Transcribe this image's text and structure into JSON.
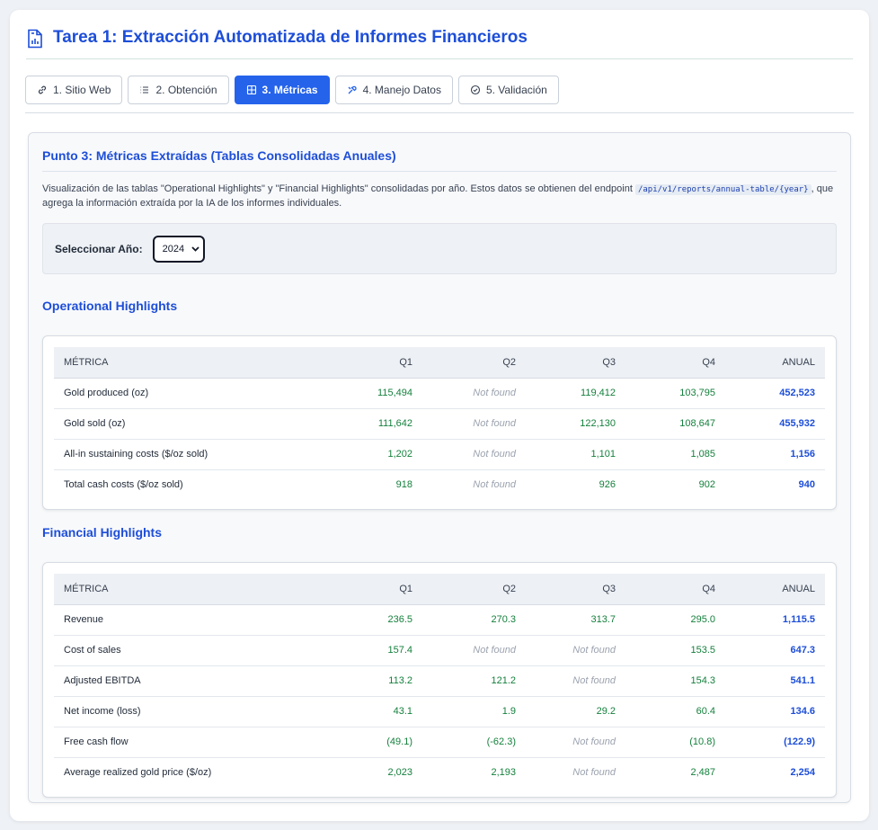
{
  "header": {
    "title": "Tarea 1: Extracción Automatizada de Informes Financieros",
    "icon": "document-chart-icon"
  },
  "tabs": [
    {
      "label": "1. Sitio Web",
      "icon": "link-icon",
      "active": false
    },
    {
      "label": "2. Obtención",
      "icon": "list-icon",
      "active": false
    },
    {
      "label": "3. Métricas",
      "icon": "grid-icon",
      "active": true
    },
    {
      "label": "4. Manejo Datos",
      "icon": "tools-icon",
      "active": false
    },
    {
      "label": "5. Validación",
      "icon": "check-circle-icon",
      "active": false
    }
  ],
  "panel": {
    "title": "Punto 3: Métricas Extraídas (Tablas Consolidadas Anuales)",
    "desc_before": "Visualización de las tablas \"Operational Highlights\" y \"Financial Highlights\" consolidadas por año. Estos datos se obtienen del endpoint ",
    "endpoint": "/api/v1/reports/annual-table/{year}",
    "desc_after": ", que agrega la información extraída por la IA de los informes individuales.",
    "year_label": "Seleccionar Año:",
    "year_value": "2024"
  },
  "operational": {
    "title": "Operational Highlights",
    "columns": [
      "MÉTRICA",
      "Q1",
      "Q2",
      "Q3",
      "Q4",
      "ANUAL"
    ],
    "rows": [
      [
        "Gold produced (oz)",
        "115,494",
        "Not found",
        "119,412",
        "103,795",
        "452,523"
      ],
      [
        "Gold sold (oz)",
        "111,642",
        "Not found",
        "122,130",
        "108,647",
        "455,932"
      ],
      [
        "All-in sustaining costs ($/oz sold)",
        "1,202",
        "Not found",
        "1,101",
        "1,085",
        "1,156"
      ],
      [
        "Total cash costs ($/oz sold)",
        "918",
        "Not found",
        "926",
        "902",
        "940"
      ]
    ]
  },
  "financial": {
    "title": "Financial Highlights",
    "columns": [
      "MÉTRICA",
      "Q1",
      "Q2",
      "Q3",
      "Q4",
      "ANUAL"
    ],
    "rows": [
      [
        "Revenue",
        "236.5",
        "270.3",
        "313.7",
        "295.0",
        "1,115.5"
      ],
      [
        "Cost of sales",
        "157.4",
        "Not found",
        "Not found",
        "153.5",
        "647.3"
      ],
      [
        "Adjusted EBITDA",
        "113.2",
        "121.2",
        "Not found",
        "154.3",
        "541.1"
      ],
      [
        "Net income (loss)",
        "43.1",
        "1.9",
        "29.2",
        "60.4",
        "134.6"
      ],
      [
        "Free cash flow",
        "(49.1)",
        "(-62.3)",
        "Not found",
        "(10.8)",
        "(122.9)"
      ],
      [
        "Average realized gold price ($/oz)",
        "2,023",
        "2,193",
        "Not found",
        "2,487",
        "2,254"
      ]
    ]
  }
}
